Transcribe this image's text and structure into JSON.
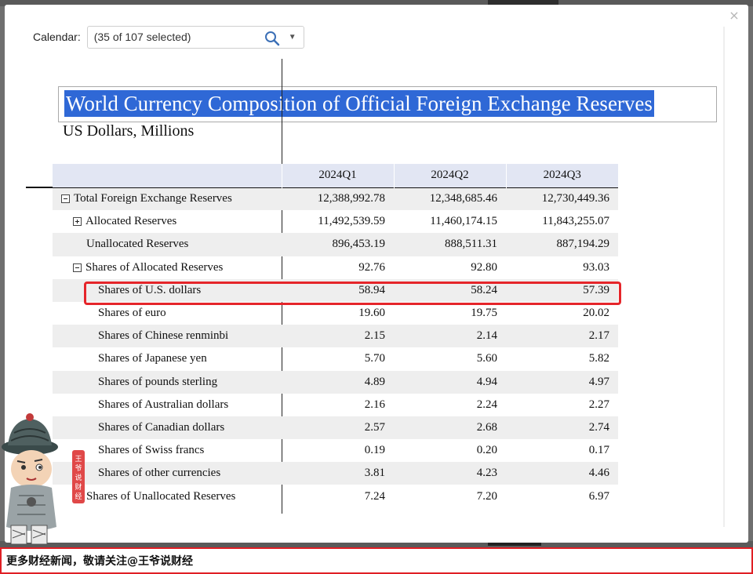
{
  "calendar": {
    "label": "Calendar:",
    "value": "(35 of 107 selected)"
  },
  "report": {
    "title": "World Currency Composition of Official Foreign Exchange Reserves",
    "subtitle": "US Dollars, Millions"
  },
  "table": {
    "columns": [
      "2024Q1",
      "2024Q2",
      "2024Q3"
    ],
    "rows": [
      {
        "label": "Total Foreign Exchange Reserves",
        "values": [
          "12,388,992.78",
          "12,348,685.46",
          "12,730,449.36"
        ]
      },
      {
        "label": "Allocated Reserves",
        "values": [
          "11,492,539.59",
          "11,460,174.15",
          "11,843,255.07"
        ]
      },
      {
        "label": "Unallocated Reserves",
        "values": [
          "896,453.19",
          "888,511.31",
          "887,194.29"
        ]
      },
      {
        "label": "Shares of Allocated Reserves",
        "values": [
          "92.76",
          "92.80",
          "93.03"
        ]
      },
      {
        "label": "Shares of U.S. dollars",
        "values": [
          "58.94",
          "58.24",
          "57.39"
        ]
      },
      {
        "label": "Shares of euro",
        "values": [
          "19.60",
          "19.75",
          "20.02"
        ]
      },
      {
        "label": "Shares of Chinese renminbi",
        "values": [
          "2.15",
          "2.14",
          "2.17"
        ]
      },
      {
        "label": "Shares of Japanese yen",
        "values": [
          "5.70",
          "5.60",
          "5.82"
        ]
      },
      {
        "label": "Shares of pounds sterling",
        "values": [
          "4.89",
          "4.94",
          "4.97"
        ]
      },
      {
        "label": "Shares of Australian dollars",
        "values": [
          "2.16",
          "2.24",
          "2.27"
        ]
      },
      {
        "label": "Shares of Canadian dollars",
        "values": [
          "2.57",
          "2.68",
          "2.74"
        ]
      },
      {
        "label": "Shares of Swiss francs",
        "values": [
          "0.19",
          "0.20",
          "0.17"
        ]
      },
      {
        "label": "Shares of other currencies",
        "values": [
          "3.81",
          "4.23",
          "4.46"
        ]
      },
      {
        "label": "Shares of Unallocated Reserves",
        "values": [
          "7.24",
          "7.20",
          "6.97"
        ]
      }
    ]
  },
  "mascot": {
    "banner_text": "王爷说财经"
  },
  "footer": {
    "text": "更多财经新闻，敬请关注@王爷说财经"
  },
  "colors": {
    "title_highlight": "#2f68d6",
    "row_highlight_border": "#e5252a",
    "header_bg": "#e2e6f3",
    "footer_border": "#e01f25"
  }
}
